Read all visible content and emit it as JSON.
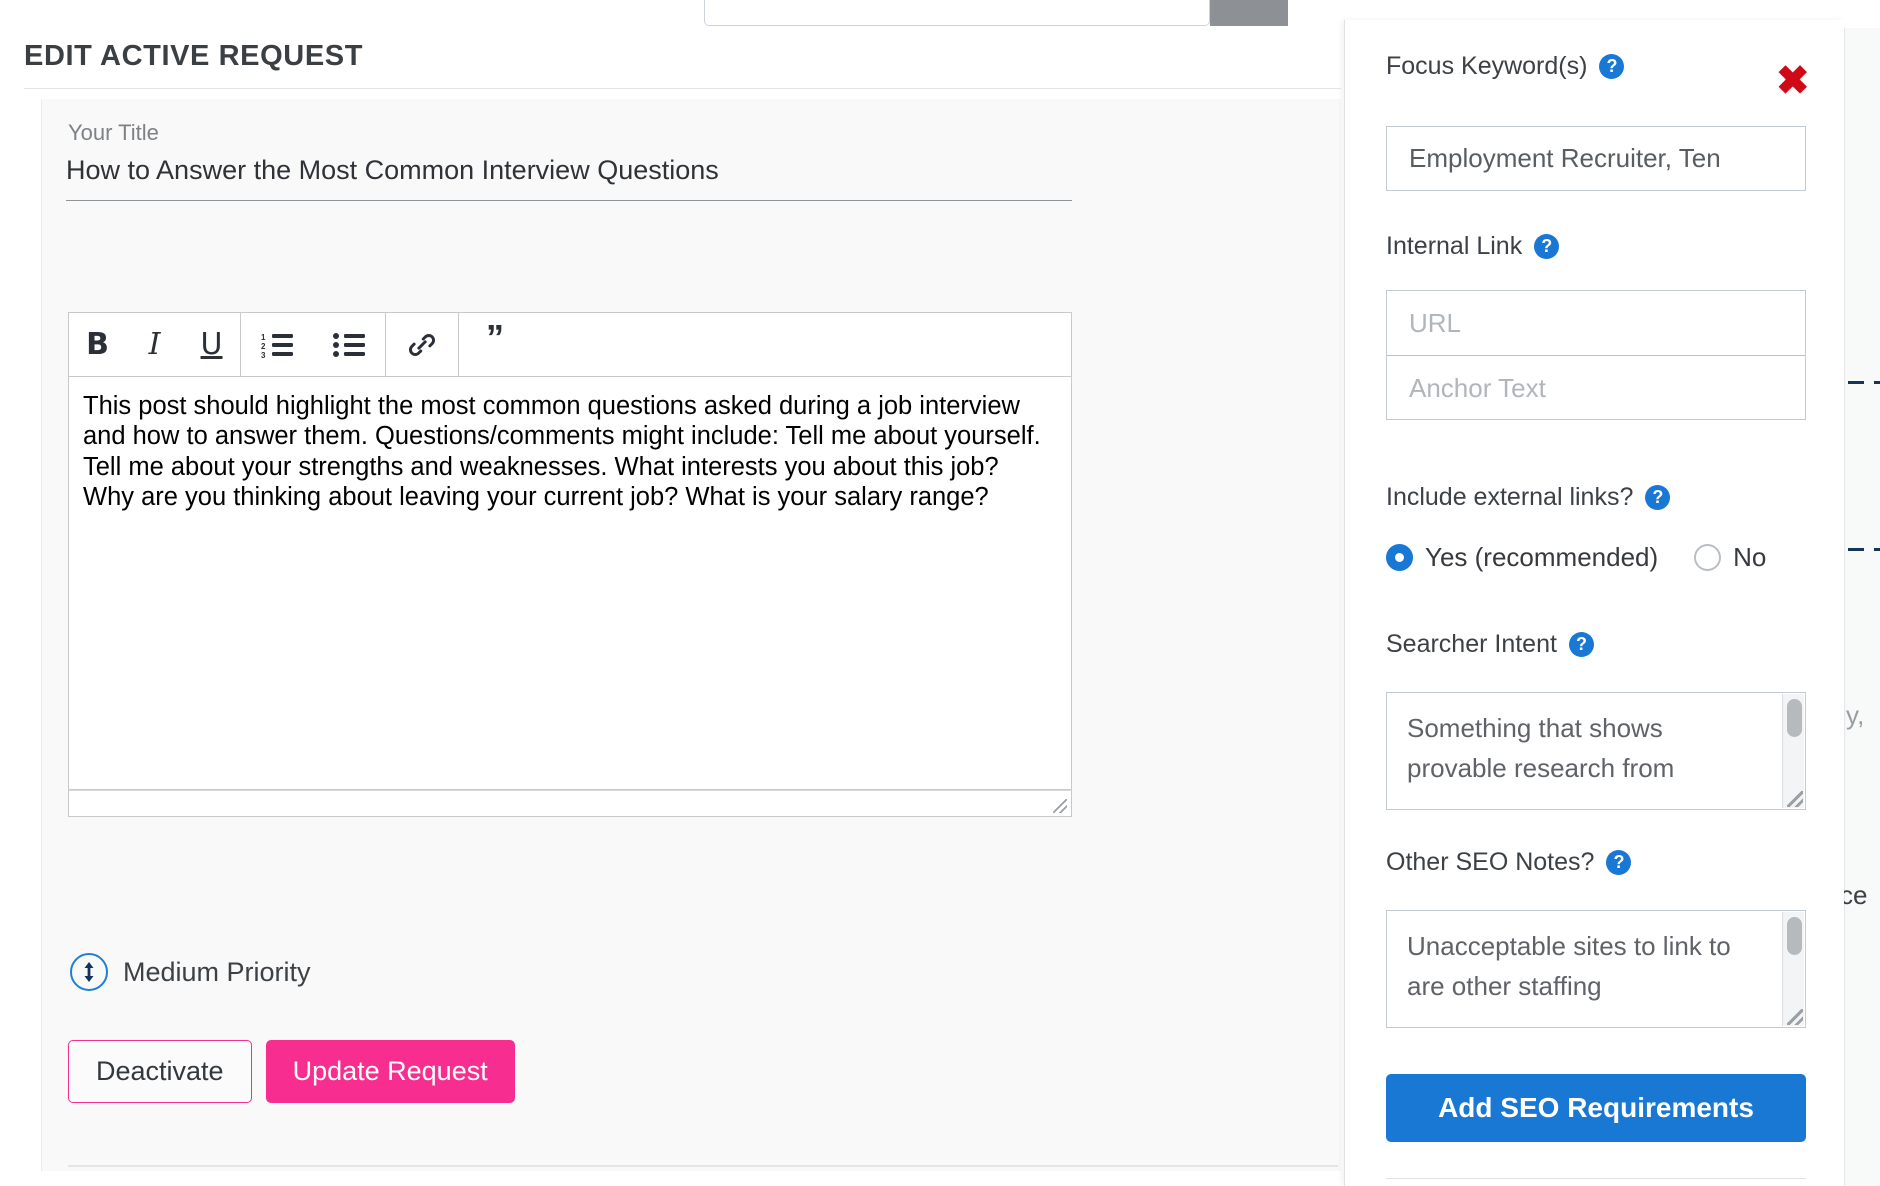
{
  "top": {
    "search_placeholder": "",
    "search_button_label": ""
  },
  "main": {
    "page_title": "EDIT ACTIVE REQUEST",
    "title_field_label": "Your Title",
    "title_value": "How to Answer the Most Common Interview Questions",
    "editor": {
      "toolbar": [
        {
          "name": "bold",
          "glyph": "B"
        },
        {
          "name": "italic",
          "glyph": "I"
        },
        {
          "name": "underline",
          "glyph": "U"
        },
        {
          "name": "ordered-list",
          "glyph": ""
        },
        {
          "name": "bullet-list",
          "glyph": ""
        },
        {
          "name": "link",
          "glyph": ""
        },
        {
          "name": "blockquote",
          "glyph": "”"
        }
      ],
      "body_text": "This post should highlight the most common questions asked during a job interview and how to answer them. Questions/comments might include: Tell me about yourself. Tell me about your strengths and weaknesses. What interests you about this job? Why are you thinking about leaving your current job? What is your salary range?"
    },
    "priority_label": "Medium Priority",
    "deactivate_label": "Deactivate",
    "update_label": "Update Request"
  },
  "seo_panel": {
    "close_label": "✖",
    "help_glyph": "?",
    "focus_keyword": {
      "label": "Focus Keyword(s)",
      "value": "Employment Recruiter, Ten"
    },
    "internal_link": {
      "label": "Internal Link",
      "url_placeholder": "URL",
      "anchor_placeholder": "Anchor Text",
      "url_value": "",
      "anchor_value": ""
    },
    "external_links": {
      "label": "Include external links?",
      "options": [
        {
          "label": "Yes (recommended)",
          "selected": true
        },
        {
          "label": "No",
          "selected": false
        }
      ]
    },
    "searcher_intent": {
      "label": "Searcher Intent",
      "value": "Something that shows provable research from"
    },
    "other_notes": {
      "label": "Other SEO Notes?",
      "value": "Unacceptable sites to link to are other staffing"
    },
    "submit_label": "Add SEO Requirements"
  },
  "background_right": {
    "fragment_1": "y,",
    "fragment_2": "ce"
  },
  "colors": {
    "accent_blue": "#1878d4",
    "accent_pink": "#f72d8f",
    "close_red": "#cf0a16",
    "panel_bg": "#ffffff",
    "card_bg": "#f9f9f9"
  }
}
